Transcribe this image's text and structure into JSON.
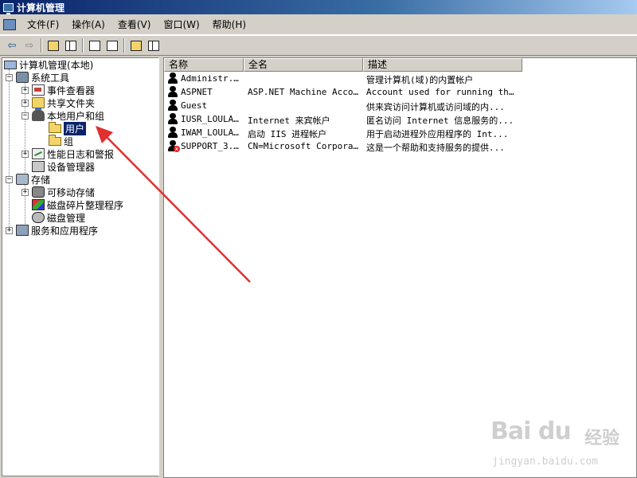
{
  "window": {
    "title": "计算机管理"
  },
  "menu": [
    "文件(F)",
    "操作(A)",
    "查看(V)",
    "窗口(W)",
    "帮助(H)"
  ],
  "toolbar": {
    "back_icon": "arrow-left-icon",
    "forward_icon": "arrow-right-icon",
    "back_glyph": "⇦",
    "forward_glyph": "⇨"
  },
  "tree": {
    "root": "计算机管理(本地)",
    "system_tools": "系统工具",
    "event_viewer": "事件查看器",
    "shared_folders": "共享文件夹",
    "local_users_groups": "本地用户和组",
    "users": "用户",
    "groups": "组",
    "perf_logs": "性能日志和警报",
    "device_manager": "设备管理器",
    "storage": "存储",
    "removable_storage": "可移动存储",
    "disk_defrag": "磁盘碎片整理程序",
    "disk_management": "磁盘管理",
    "services_apps": "服务和应用程序",
    "expand_plus": "+",
    "expand_minus": "−"
  },
  "list": {
    "columns": [
      "名称",
      "全名",
      "描述"
    ],
    "rows": [
      {
        "name": "Administr...",
        "fullname": "",
        "desc": "管理计算机(域)的内置帐户"
      },
      {
        "name": "ASPNET",
        "fullname": "ASP.NET Machine Account",
        "desc": "Account used for running the..."
      },
      {
        "name": "Guest",
        "fullname": "",
        "desc": "供来宾访问计算机或访问域的内..."
      },
      {
        "name": "IUSR_LOULAND",
        "fullname": "Internet 来宾帐户",
        "desc": "匿名访问 Internet 信息服务的..."
      },
      {
        "name": "IWAM_LOULAND",
        "fullname": "启动 IIS 进程帐户",
        "desc": "用于启动进程外应用程序的 Int..."
      },
      {
        "name": "SUPPORT_3...",
        "fullname": "CN=Microsoft Corpora...",
        "desc": "这是一个帮助和支持服务的提供..."
      }
    ],
    "disabled_mark": "x"
  },
  "annotation": {
    "arrow_color": "#e03030"
  },
  "watermark": {
    "main": "Bai du",
    "sub": "经验",
    "url": "jingyan.baidu.com"
  },
  "colors": {
    "title_bar": "#0a246a",
    "selection": "#0a246a",
    "face": "#d4d0c8"
  }
}
